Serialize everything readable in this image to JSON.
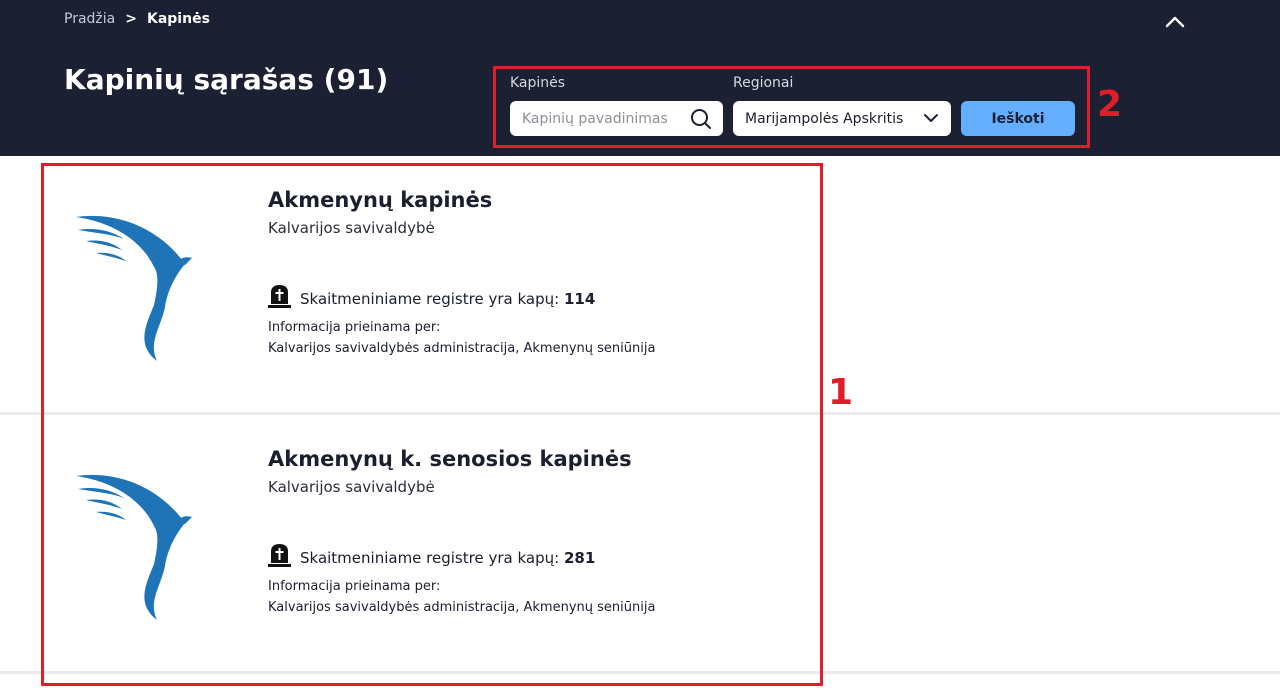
{
  "breadcrumb": {
    "home": "Pradžia",
    "separator": ">",
    "current": "Kapinės"
  },
  "header": {
    "title": "Kapinių sąrašas (91)"
  },
  "filters": {
    "name_label": "Kapinės",
    "name_placeholder": "Kapinių pavadinimas",
    "region_label": "Regionai",
    "region_value": "Marijampolės Apskritis",
    "search_button": "Ieškoti"
  },
  "annotations": {
    "results_marker": "1",
    "filters_marker": "2"
  },
  "results": [
    {
      "title": "Akmenynų kapinės",
      "municipality": "Kalvarijos savivaldybė",
      "count_text": "Skaitmeniniame registre yra kapų:",
      "count": "114",
      "info_label": "Informacija prieinama per:",
      "info_value": "Kalvarijos savivaldybės administracija, Akmenynų seniūnija"
    },
    {
      "title": "Akmenynų k. senosios kapinės",
      "municipality": "Kalvarijos savivaldybė",
      "count_text": "Skaitmeniniame registre yra kapų:",
      "count": "281",
      "info_label": "Informacija prieinama per:",
      "info_value": "Kalvarijos savivaldybės administracija, Akmenynų seniūnija"
    }
  ],
  "colors": {
    "header_bg": "#1c2033",
    "accent": "#64aeff",
    "bird": "#1f74b8",
    "annotation": "#e11d2a"
  }
}
